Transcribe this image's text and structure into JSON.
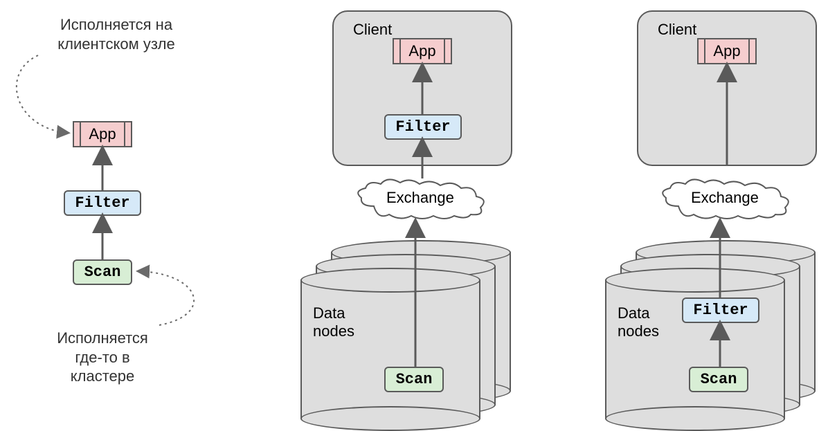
{
  "labels": {
    "app": "App",
    "filter": "Filter",
    "scan": "Scan",
    "client": "Client",
    "exchange": "Exchange",
    "data_nodes_line1": "Data",
    "data_nodes_line2": "nodes"
  },
  "annotations": {
    "top_line1": "Исполняется на",
    "top_line2": "клиентском узле",
    "bottom_line1": "Исполняется",
    "bottom_line2": "где-то в",
    "bottom_line3": "кластере"
  },
  "colors": {
    "app_bg": "#f5cdce",
    "filter_bg": "#d6e9f8",
    "scan_bg": "#d8eed5",
    "container_bg": "#dedede",
    "stroke": "#5a5a5a"
  },
  "diagram": {
    "columns": 3,
    "col1": {
      "annotation_top": "Исполняется на клиентском узле",
      "annotation_bottom": "Исполняется где-то в кластере",
      "flow": [
        "App",
        "Filter",
        "Scan"
      ]
    },
    "col2": {
      "client": {
        "contains": [
          "App",
          "Filter"
        ]
      },
      "exchange": true,
      "data_nodes": {
        "contains": [
          "Scan"
        ]
      }
    },
    "col3": {
      "client": {
        "contains": [
          "App"
        ]
      },
      "exchange": true,
      "data_nodes": {
        "contains": [
          "Filter",
          "Scan"
        ]
      }
    }
  }
}
